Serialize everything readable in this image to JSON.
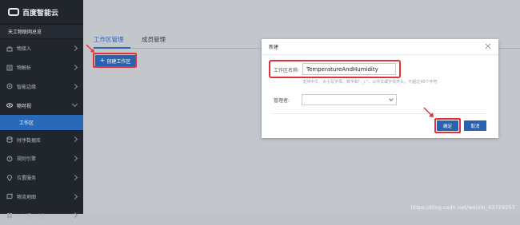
{
  "app": {
    "logo_text": "百度智能云",
    "workspace": "天工物联网总览"
  },
  "sidebar": {
    "items": [
      {
        "label": "物接入",
        "icon": "plug-icon"
      },
      {
        "label": "物解析",
        "icon": "parse-icon"
      },
      {
        "label": "智能边缘",
        "icon": "edge-icon"
      },
      {
        "label": "物可视",
        "icon": "eye-icon",
        "open": true,
        "sub": "工作区"
      },
      {
        "label": "时序数据库",
        "icon": "database-icon"
      },
      {
        "label": "规则引擎",
        "icon": "rules-icon"
      },
      {
        "label": "位置服务",
        "icon": "location-icon"
      },
      {
        "label": "物流地图",
        "icon": "map-icon"
      },
      {
        "label": "平台通用功能",
        "icon": "platform-icon"
      }
    ]
  },
  "tabs": [
    {
      "label": "工作区管理",
      "active": true
    },
    {
      "label": "成员管理",
      "active": false
    }
  ],
  "create_button": {
    "label": "创建工作区",
    "icon": "plus-icon"
  },
  "dialog": {
    "title": "新建",
    "name_label": "工作区名称:",
    "name_value": "TemperatureAndHumidity",
    "name_hint": "支持中文、大小写字母、数字和\"-_/.\"，以中文或字母开头，不超过40个字符",
    "manager_label": "管理者:",
    "manager_value": "",
    "confirm_label": "确定",
    "cancel_label": "取消"
  },
  "watermark": "https://blog.csdn.net/weixin_43729257",
  "colors": {
    "accent": "#2b62b0",
    "highlight": "#e0313d",
    "sidebar": "#21252c",
    "active_nav": "#2a69b8"
  }
}
